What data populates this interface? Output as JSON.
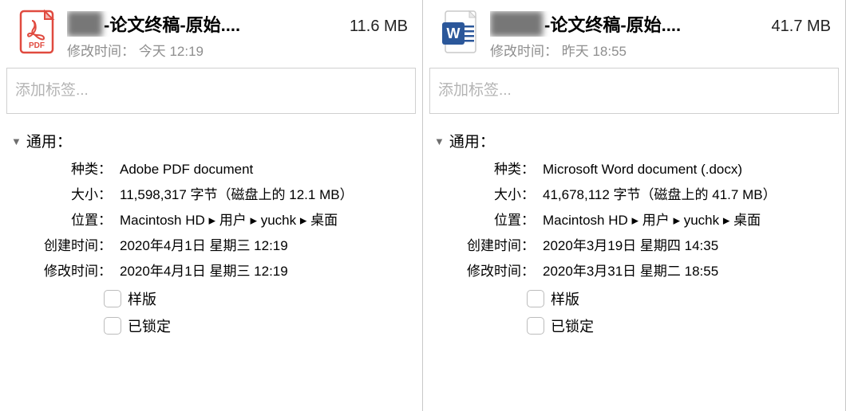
{
  "left": {
    "filename_suffix": "-论文终稿-原始....",
    "obscured_prefix": "名字",
    "filesize": "11.6 MB",
    "modified_line": "修改时间：  今天 12:19",
    "tags_placeholder": "添加标签...",
    "section_title": "通用：",
    "rows": {
      "kind_label": "种类：",
      "kind_value": "Adobe PDF document",
      "size_label": "大小：",
      "size_value": "11,598,317 字节（磁盘上的 12.1 MB）",
      "where_label": "位置：",
      "where_value": "Macintosh HD ▸ 用户 ▸ yuchk ▸ 桌面",
      "created_label": "创建时间：",
      "created_value": "2020年4月1日 星期三 12:19",
      "modified_label": "修改时间：",
      "modified_value": "2020年4月1日 星期三 12:19"
    },
    "checkboxes": {
      "stationery": "样版",
      "locked": "已锁定"
    }
  },
  "right": {
    "filename_suffix": "-论文终稿-原始....",
    "obscured_prefix": "名字名",
    "filesize": "41.7 MB",
    "modified_line": "修改时间：  昨天 18:55",
    "tags_placeholder": "添加标签...",
    "section_title": "通用：",
    "rows": {
      "kind_label": "种类：",
      "kind_value": "Microsoft Word document (.docx)",
      "size_label": "大小：",
      "size_value": "41,678,112 字节（磁盘上的 41.7 MB）",
      "where_label": "位置：",
      "where_value": "Macintosh HD ▸ 用户 ▸ yuchk ▸ 桌面",
      "created_label": "创建时间：",
      "created_value": "2020年3月19日 星期四 14:35",
      "modified_label": "修改时间：",
      "modified_value": "2020年3月31日 星期二 18:55"
    },
    "checkboxes": {
      "stationery": "样版",
      "locked": "已锁定"
    }
  }
}
